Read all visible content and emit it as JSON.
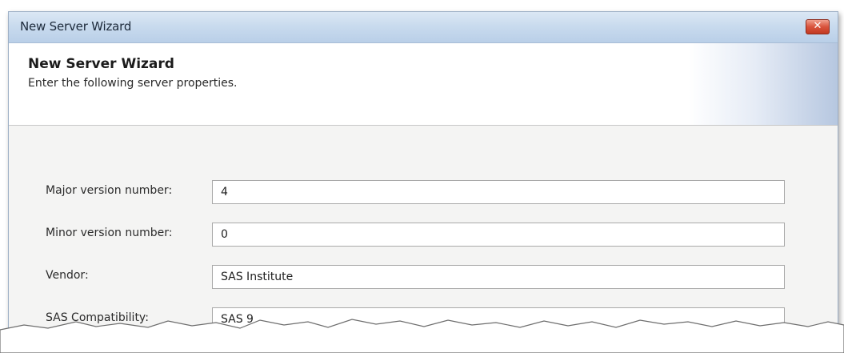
{
  "window": {
    "title": "New Server Wizard",
    "close_symbol": "✕"
  },
  "header": {
    "title": "New Server Wizard",
    "subtitle": "Enter the following server properties."
  },
  "form": {
    "fields": [
      {
        "label": "Major version number:",
        "value": "4"
      },
      {
        "label": "Minor version number:",
        "value": "0"
      },
      {
        "label": "Vendor:",
        "value": "SAS Institute"
      },
      {
        "label": "SAS Compatibility:",
        "value": "SAS 9"
      }
    ]
  },
  "icons": {
    "close": "close-icon"
  },
  "colors": {
    "titlebar": "#c9dbee",
    "close_button": "#d9533c",
    "header_gradient_end": "#b6c7e0"
  }
}
